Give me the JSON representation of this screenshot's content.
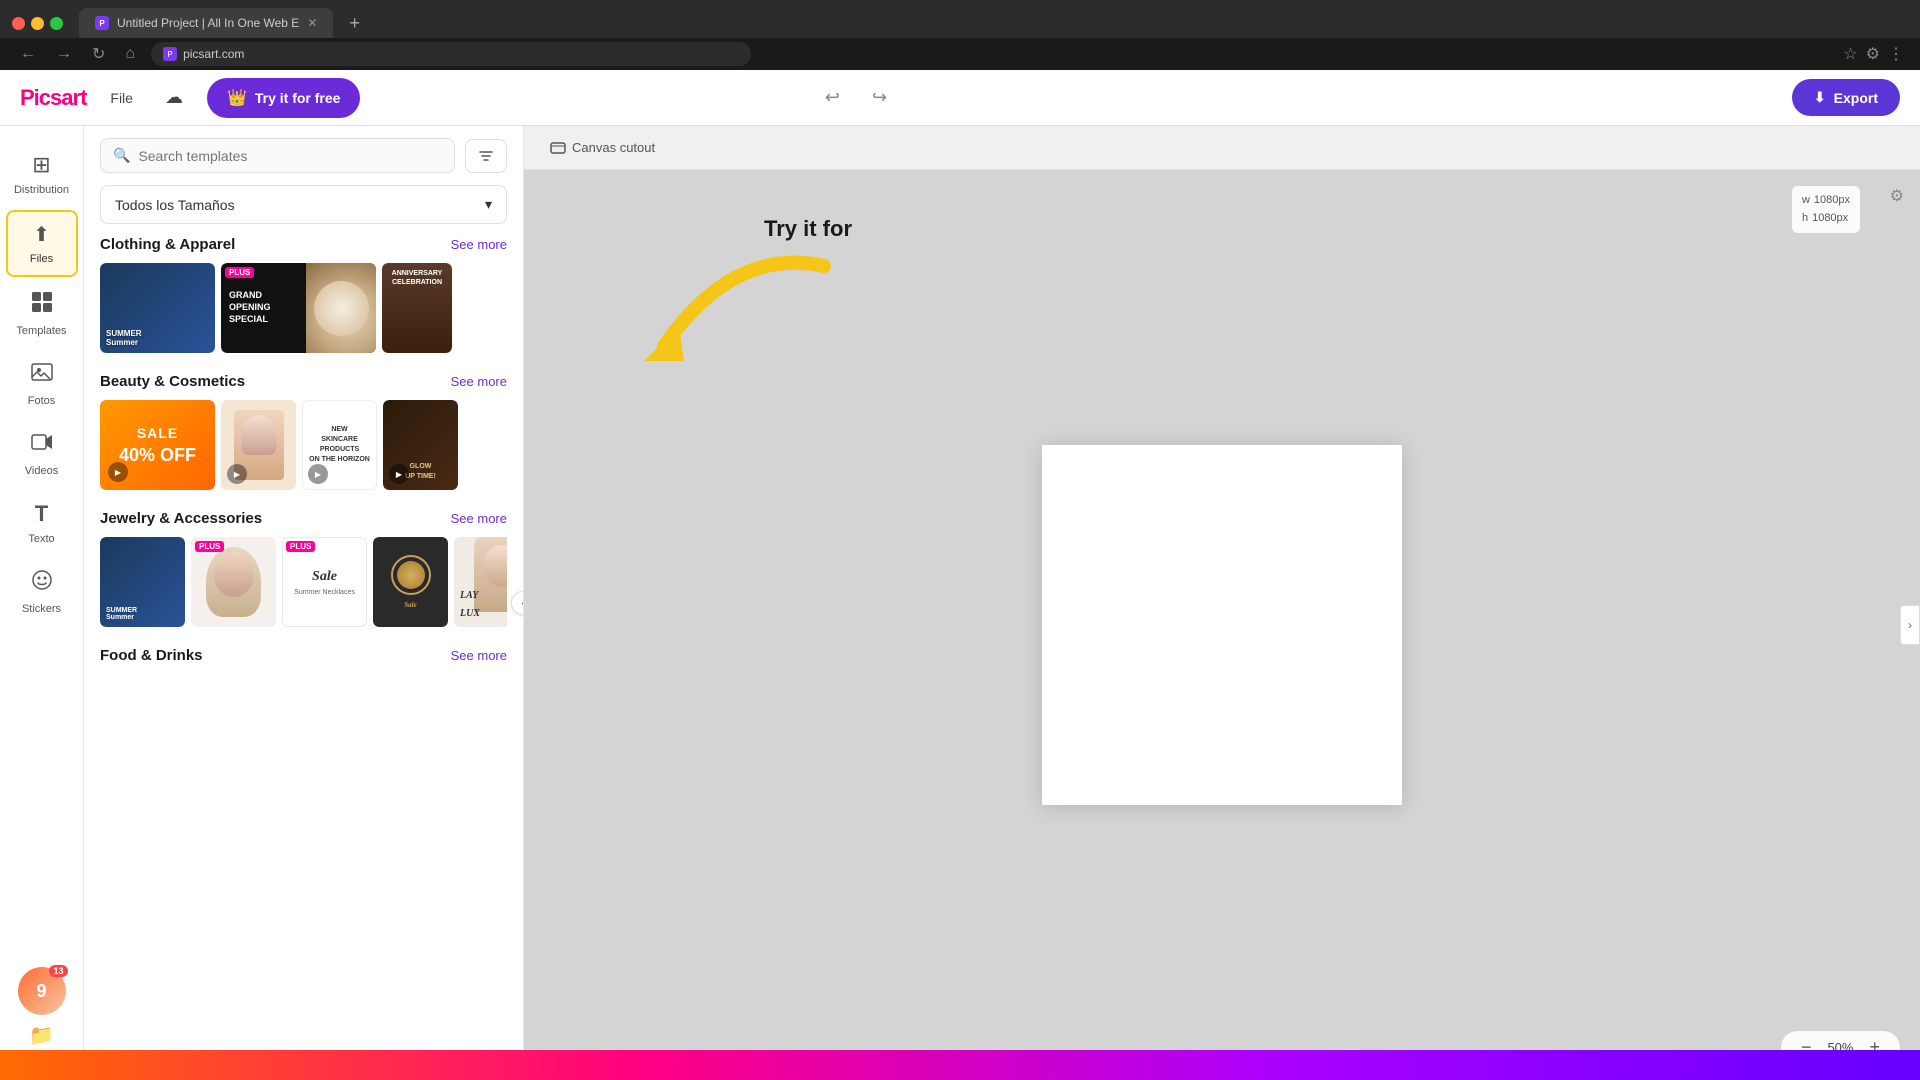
{
  "browser": {
    "tab_title": "Untitled Project | All In One Web E",
    "url": "picsart.com",
    "favicon_letter": "P"
  },
  "header": {
    "logo_text": "Picsart",
    "file_label": "File",
    "try_free_label": "Try it for free",
    "try_free_icon": "👑",
    "undo_icon": "↩",
    "redo_icon": "↪",
    "export_label": "Export",
    "export_icon": "⬇"
  },
  "sidebar": {
    "items": [
      {
        "id": "distribution",
        "label": "Distribution",
        "icon": "⊞"
      },
      {
        "id": "files",
        "label": "Files",
        "icon": "⬆",
        "active": true
      },
      {
        "id": "templates",
        "label": "Templates",
        "icon": "⊡"
      },
      {
        "id": "photos",
        "label": "Fotos",
        "icon": "🖼"
      },
      {
        "id": "videos",
        "label": "Videos",
        "icon": "🎬"
      },
      {
        "id": "text",
        "label": "Texto",
        "icon": "T"
      },
      {
        "id": "stickers",
        "label": "Stickers",
        "icon": "😊"
      }
    ],
    "avatar_letter": "9",
    "badge_count": "13",
    "folders_label": "my folders"
  },
  "content_panel": {
    "search_placeholder": "Search templates",
    "size_dropdown_label": "Todos los Tamaños",
    "categories": [
      {
        "id": "clothing",
        "title": "Clothing & Apparel",
        "see_more": "See more"
      },
      {
        "id": "beauty",
        "title": "Beauty & Cosmetics",
        "see_more": "See more"
      },
      {
        "id": "jewelry",
        "title": "Jewelry & Accessories",
        "see_more": "See more"
      },
      {
        "id": "food",
        "title": "Food & Drinks",
        "see_more": "See more"
      }
    ]
  },
  "canvas": {
    "tool_label": "Canvas cutout",
    "width_label": "w",
    "width_value": "1080px",
    "height_label": "h",
    "height_value": "1080px",
    "zoom_value": "50%"
  },
  "annotation": {
    "arrow_text": "Try it for free"
  },
  "zoom": {
    "minus": "−",
    "plus": "+",
    "value": "50%"
  }
}
